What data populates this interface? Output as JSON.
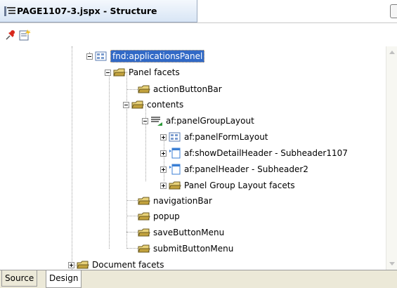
{
  "window": {
    "title": "PAGE1107-3.jspx - Structure"
  },
  "toolbar": {
    "buttons": [
      "pin-icon",
      "new-structure-icon"
    ]
  },
  "tree": {
    "nodes": {
      "fnd_applicationsPanel": "fnd:applicationsPanel",
      "panel_facets": "Panel facets",
      "actionButtonBar": "actionButtonBar",
      "contents": "contents",
      "panelGroupLayout": "af:panelGroupLayout",
      "panelFormLayout": "af:panelFormLayout",
      "showDetailHeader": "af:showDetailHeader - Subheader1107",
      "panelHeader": "af:panelHeader - Subheader2",
      "panelGroupLayoutFacets": "Panel Group Layout facets",
      "navigationBar": "navigationBar",
      "popup": "popup",
      "saveButtonMenu": "saveButtonMenu",
      "submitButtonMenu": "submitButtonMenu",
      "documentFacets": "Document facets"
    }
  },
  "bottom_tabs": [
    "Source",
    "Design"
  ],
  "colors": {
    "selection": "#3169c6",
    "folder": "#e8d27a",
    "tab_bg": "#ece9d8"
  }
}
